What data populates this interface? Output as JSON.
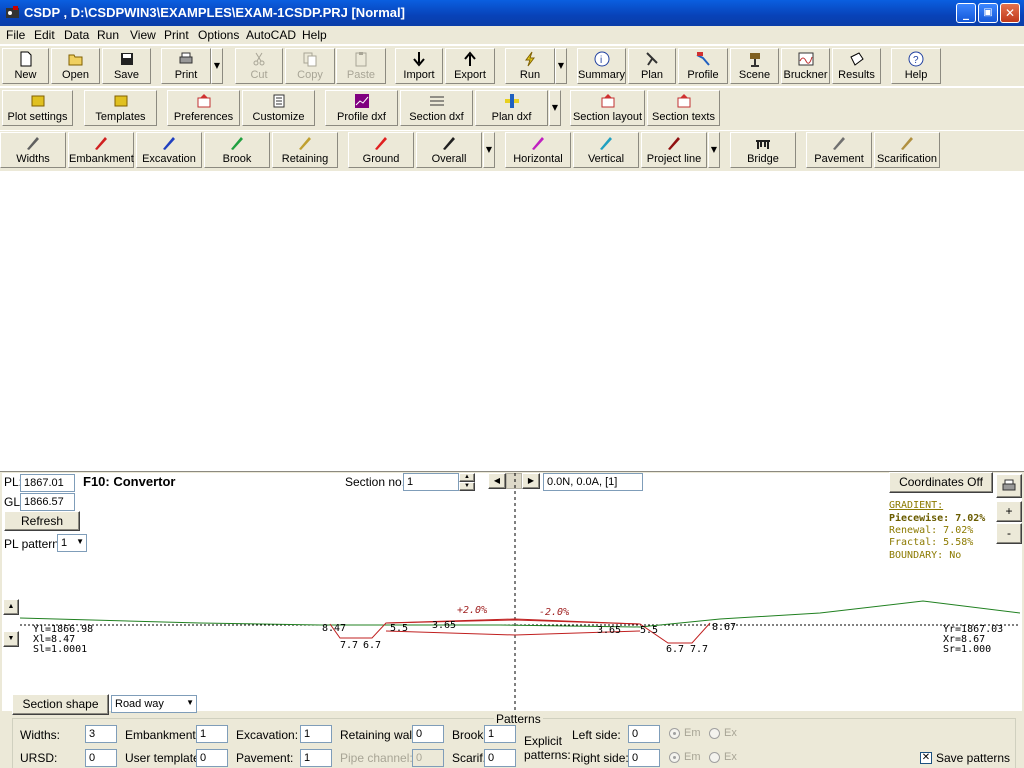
{
  "window": {
    "title": "CSDP , D:\\CSDPWIN3\\EXAMPLES\\EXAM-1CSDP.PRJ [Normal]",
    "minimize": "_",
    "maximize": "▣",
    "close": "✕"
  },
  "menu": [
    "File",
    "Edit",
    "Data",
    "Run",
    "View",
    "Print",
    "Options",
    "AutoCAD",
    "Help"
  ],
  "toolbar1": {
    "new": "New",
    "open": "Open",
    "save": "Save",
    "print": "Print",
    "cut": "Cut",
    "copy": "Copy",
    "paste": "Paste",
    "import": "Import",
    "export": "Export",
    "run": "Run",
    "summary": "Summary",
    "plan": "Plan",
    "profile": "Profile",
    "scene": "Scene",
    "bruckner": "Bruckner",
    "results": "Results",
    "help": "Help"
  },
  "toolbar2": {
    "plot_settings": "Plot settings",
    "templates": "Templates",
    "preferences": "Preferences",
    "customize": "Customize",
    "profile_dxf": "Profile dxf",
    "section_dxf": "Section dxf",
    "plan_dxf": "Plan dxf",
    "section_layout": "Section layout",
    "section_texts": "Section texts"
  },
  "toolbar3": {
    "widths": "Widths",
    "embankment": "Embankment",
    "excavation": "Excavation",
    "brook": "Brook",
    "retaining": "Retaining",
    "ground": "Ground",
    "overall": "Overall",
    "horizontal": "Horizontal",
    "vertical": "Vertical",
    "project_line": "Project line",
    "bridge": "Bridge",
    "pavement": "Pavement",
    "scarification": "Scarification"
  },
  "section": {
    "pl_label": "PL:",
    "pl_value": "1867.01",
    "gl_label": "GL:",
    "gl_value": "1866.57",
    "refresh": "Refresh",
    "pl_pattern_label": "PL pattern:",
    "pl_pattern_value": "1",
    "title": "F10: Convertor",
    "section_no_label": "Section no.:",
    "section_no_value": "1",
    "status": "0.0N, 0.0A, [1]",
    "coordinates_button": "Coordinates Off",
    "zoom_in": "+",
    "zoom_out": "-",
    "scroll_up": "▲",
    "scroll_down": "▼"
  },
  "gradient": {
    "header": "GRADIENT:",
    "piecewise": "Piecewise: 7.02%",
    "renewal": "Renewal: 7.02%",
    "fractal": "Fractal: 5.58%",
    "boundary": "BOUNDARY: No"
  },
  "drawing": {
    "slope_left": "+2.0%",
    "slope_right": "-2.0%",
    "left_info": [
      "Yl=1866.98",
      "Xl=8.47",
      "Sl=1.0001"
    ],
    "right_info": [
      "Yr=1867.03",
      "Xr=8.67",
      "Sr=1.000"
    ],
    "labels": [
      "8.47",
      "7.7",
      "6.7",
      "5.5",
      "3.65",
      "3.65",
      "5.5",
      "6.7",
      "7.7",
      "8.67"
    ]
  },
  "bottom": {
    "section_shape": "Section shape",
    "road_way": "Road way",
    "patterns": "Patterns",
    "widths_label": "Widths:",
    "widths_value": "3",
    "embankment_label": "Embankment:",
    "embankment_value": "1",
    "excavation_label": "Excavation:",
    "excavation_value": "1",
    "retaining_wall_label": "Retaining wall:",
    "retaining_wall_value": "0",
    "brook_label": "Brook:",
    "brook_value": "1",
    "ursd_label": "URSD:",
    "ursd_value": "0",
    "user_template_label": "User template:",
    "user_template_value": "0",
    "pavement_label": "Pavement:",
    "pavement_value": "1",
    "pipe_channel_label": "Pipe channel:",
    "pipe_channel_value": "0",
    "scarif_label": "Scarif.:",
    "scarif_value": "0",
    "explicit_patterns": "Explicit patterns:",
    "left_side_label": "Left side:",
    "left_side_value": "0",
    "right_side_label": "Right side:",
    "right_side_value": "0",
    "em": "Em",
    "ex": "Ex",
    "save_patterns": "Save patterns"
  }
}
